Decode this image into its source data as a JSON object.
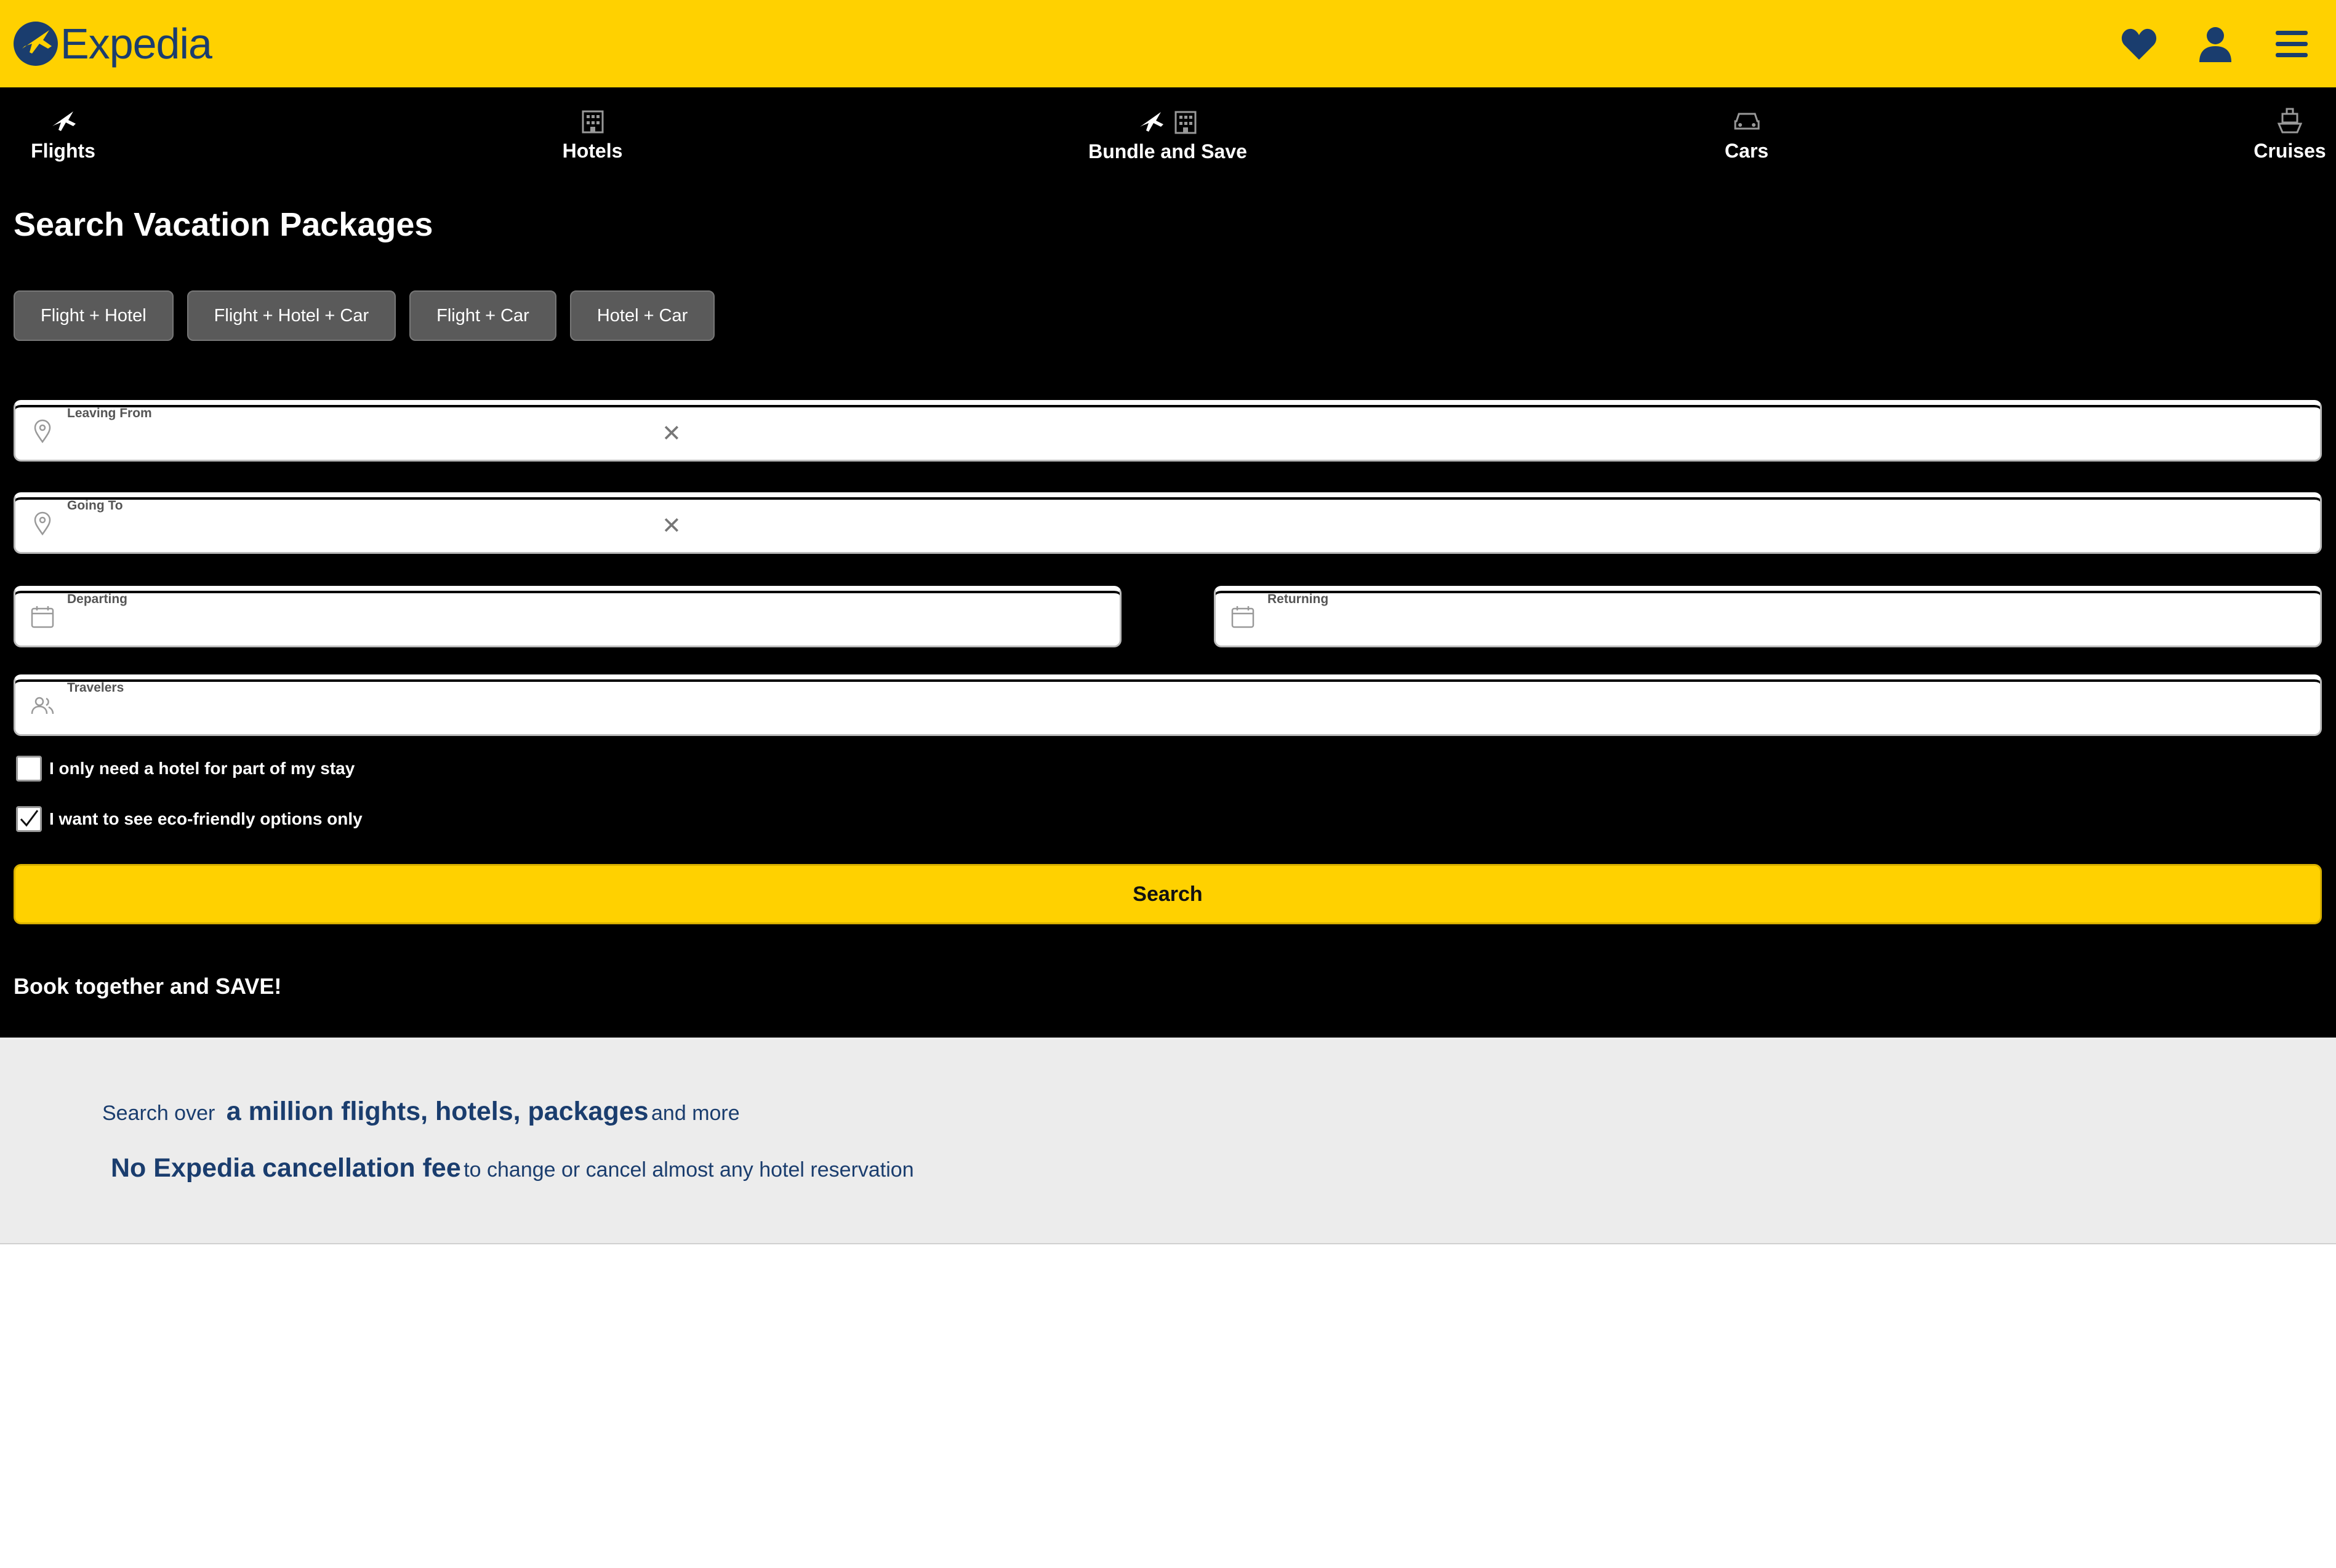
{
  "header": {
    "brand": "Expedia",
    "icons": [
      "heart-icon",
      "user-icon",
      "menu-icon"
    ],
    "colors": {
      "brand_yellow": "#FFD100",
      "brand_navy": "#1a3d6e"
    }
  },
  "nav": {
    "tabs": [
      {
        "label": "Flights",
        "icon": "plane-icon"
      },
      {
        "label": "Hotels",
        "icon": "building-icon"
      },
      {
        "label": "Bundle and Save",
        "icon": "plane-building-icon",
        "active": true
      },
      {
        "label": "Cars",
        "icon": "car-icon"
      },
      {
        "label": "Cruises",
        "icon": "ship-icon"
      }
    ]
  },
  "main": {
    "title": "Search Vacation Packages",
    "package_types": [
      "Flight + Hotel",
      "Flight + Hotel + Car",
      "Flight + Car",
      "Hotel + Car"
    ],
    "fields": {
      "leaving_from": {
        "label": "Leaving From",
        "value": ""
      },
      "going_to": {
        "label": "Going To",
        "value": ""
      },
      "departing": {
        "label": "Departing",
        "value": ""
      },
      "returning": {
        "label": "Returning",
        "value": ""
      },
      "travelers": {
        "label": "Travelers",
        "value": ""
      }
    },
    "checkboxes": [
      {
        "label": "I only need a hotel for part of my stay",
        "checked": false
      },
      {
        "label": "I want to see eco-friendly options only",
        "checked": true
      }
    ],
    "search_label": "Search",
    "save_text": "Book together and SAVE!"
  },
  "promo": {
    "line1_prefix": "Search over",
    "line1_bold": "a million flights, hotels, packages",
    "line1_suffix": "and more",
    "line2_bold": "No Expedia cancellation fee",
    "line2_suffix": "to change or cancel almost any hotel reservation"
  }
}
